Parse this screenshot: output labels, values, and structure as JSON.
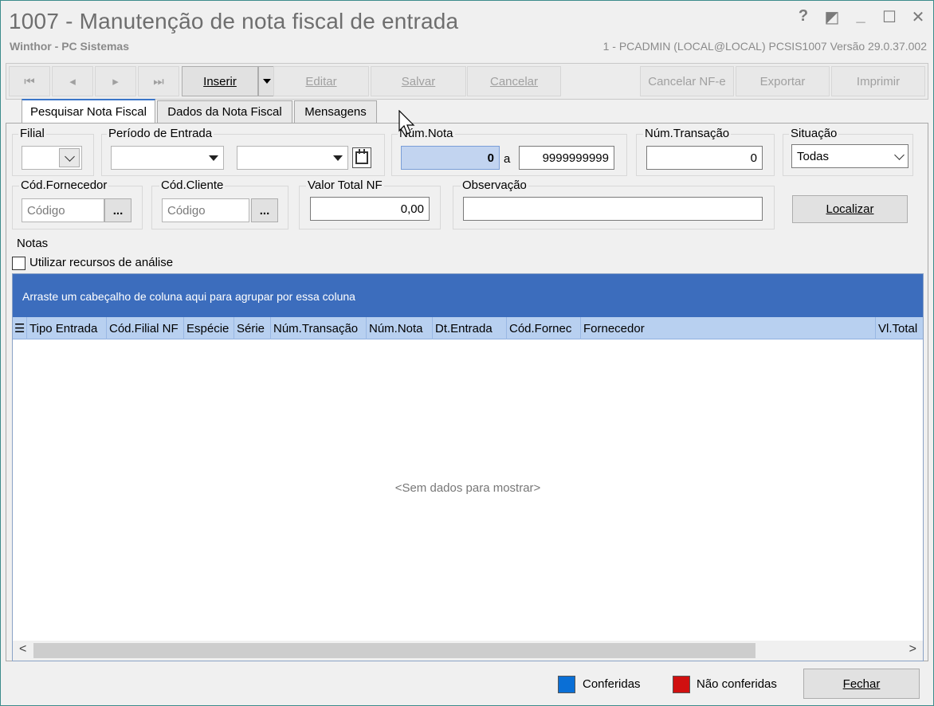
{
  "window": {
    "title": "1007 - Manutenção de nota fiscal de entrada",
    "subtitle": "Winthor - PC Sistemas",
    "info": "1 - PCADMIN (LOCAL@LOCAL)  PCSIS1007  Versão  29.0.37.002",
    "controls": {
      "help": "?",
      "restore_alt": "◩",
      "minimize": "_",
      "maximize": "☐",
      "close": "✕"
    }
  },
  "toolbar": {
    "first": "⏮",
    "prev": "◂",
    "next": "▸",
    "last": "⏭",
    "insert": "Inserir",
    "edit": "Editar",
    "save": "Salvar",
    "cancel": "Cancelar",
    "cancel_nfe": "Cancelar NF-e",
    "export": "Exportar",
    "print": "Imprimir"
  },
  "tabs": [
    "Pesquisar Nota Fiscal",
    "Dados da Nota Fiscal",
    "Mensagens"
  ],
  "filters": {
    "filial_label": "Filial",
    "periodo_label": "Período de Entrada",
    "numnota_label": "Núm.Nota",
    "numnota_from": "0",
    "numnota_sep": "a",
    "numnota_to": "9999999999",
    "numtrans_label": "Núm.Transação",
    "numtrans_value": "0",
    "situacao_label": "Situação",
    "situacao_value": "Todas",
    "codforn_label": "Cód.Fornecedor",
    "codforn_placeholder": "Código",
    "codcli_label": "Cód.Cliente",
    "codcli_placeholder": "Código",
    "ellipsis": "...",
    "valor_label": "Valor Total NF",
    "valor_value": "0,00",
    "obs_label": "Observação",
    "obs_value": "",
    "localizar": "Localizar"
  },
  "notas": {
    "label": "Notas",
    "analysis_checkbox": "Utilizar recursos de análise",
    "group_hint": "Arraste um cabeçalho de coluna aqui para agrupar por essa coluna",
    "columns": [
      "Tipo Entrada",
      "Cód.Filial NF",
      "Espécie",
      "Série",
      "Núm.Transação",
      "Núm.Nota",
      "Dt.Entrada",
      "Cód.Fornec",
      "Fornecedor",
      "Vl.Total"
    ],
    "empty": "<Sem dados para mostrar>"
  },
  "footer": {
    "legend_ok": "Conferidas",
    "legend_ok_color": "#0a6fd6",
    "legend_no": "Não conferidas",
    "legend_no_color": "#d01010",
    "close": "Fechar"
  }
}
